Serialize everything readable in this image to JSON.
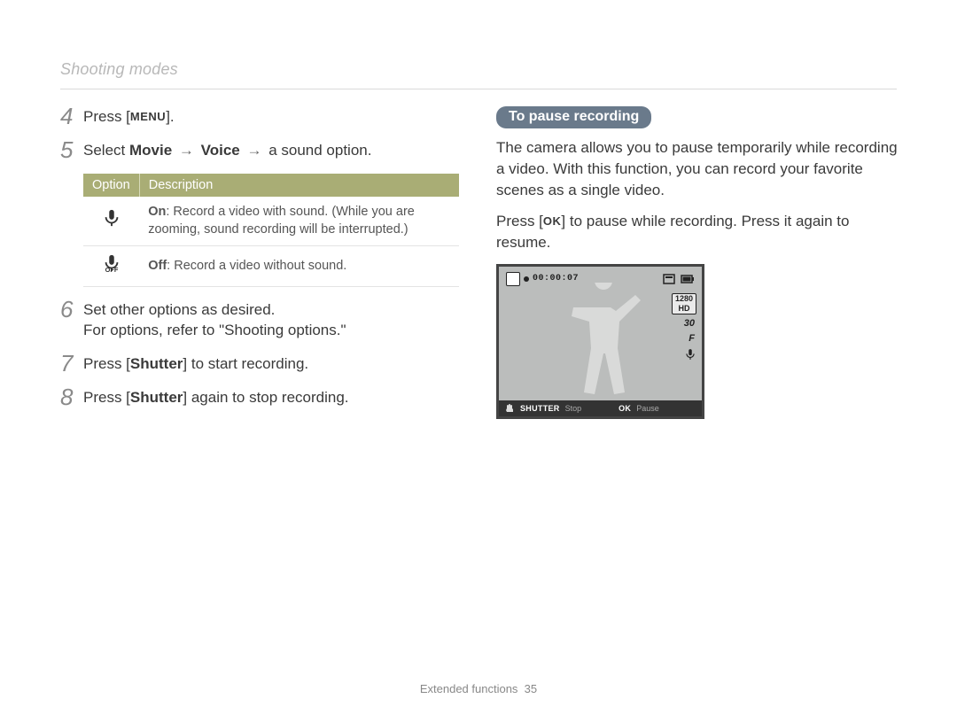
{
  "breadcrumb": "Shooting modes",
  "steps": {
    "s4": {
      "num": "4",
      "pre": "Press [",
      "key": "MENU",
      "post": "]."
    },
    "s5": {
      "num": "5",
      "pre": "Select ",
      "b1": "Movie",
      "arrow1": "→",
      "b2": "Voice",
      "arrow2": "→",
      "rest": " a sound option."
    },
    "s6": {
      "num": "6",
      "line1": "Set other options as desired.",
      "line2": "For options, refer to \"Shooting options.\""
    },
    "s7": {
      "num": "7",
      "pre": "Press [",
      "b": "Shutter",
      "post": "] to start recording."
    },
    "s8": {
      "num": "8",
      "pre": "Press [",
      "b": "Shutter",
      "post": "] again to stop recording."
    }
  },
  "table": {
    "headers": {
      "option": "Option",
      "desc": "Description"
    },
    "on_label": "On",
    "on_text": ": Record a video with sound. (While you are zooming, sound recording will be interrupted.)",
    "off_label": "Off",
    "off_text": ": Record a video without sound."
  },
  "right": {
    "callout": "To pause recording",
    "para1": "The camera allows you to pause temporarily while recording a video. With this function, you can record your favorite scenes as a single video.",
    "para2_pre": "Press [",
    "para2_key": "OK",
    "para2_post": "] to pause while recording. Press it again to resume."
  },
  "lcd": {
    "time": "00:00:07",
    "res": "1280 HD",
    "fps": "30",
    "f_icon": "F",
    "mic": "mic",
    "shutter_label": "SHUTTER",
    "shutter_action": "Stop",
    "ok_label": "OK",
    "ok_action": "Pause"
  },
  "footer": {
    "section": "Extended functions",
    "page": "35"
  }
}
